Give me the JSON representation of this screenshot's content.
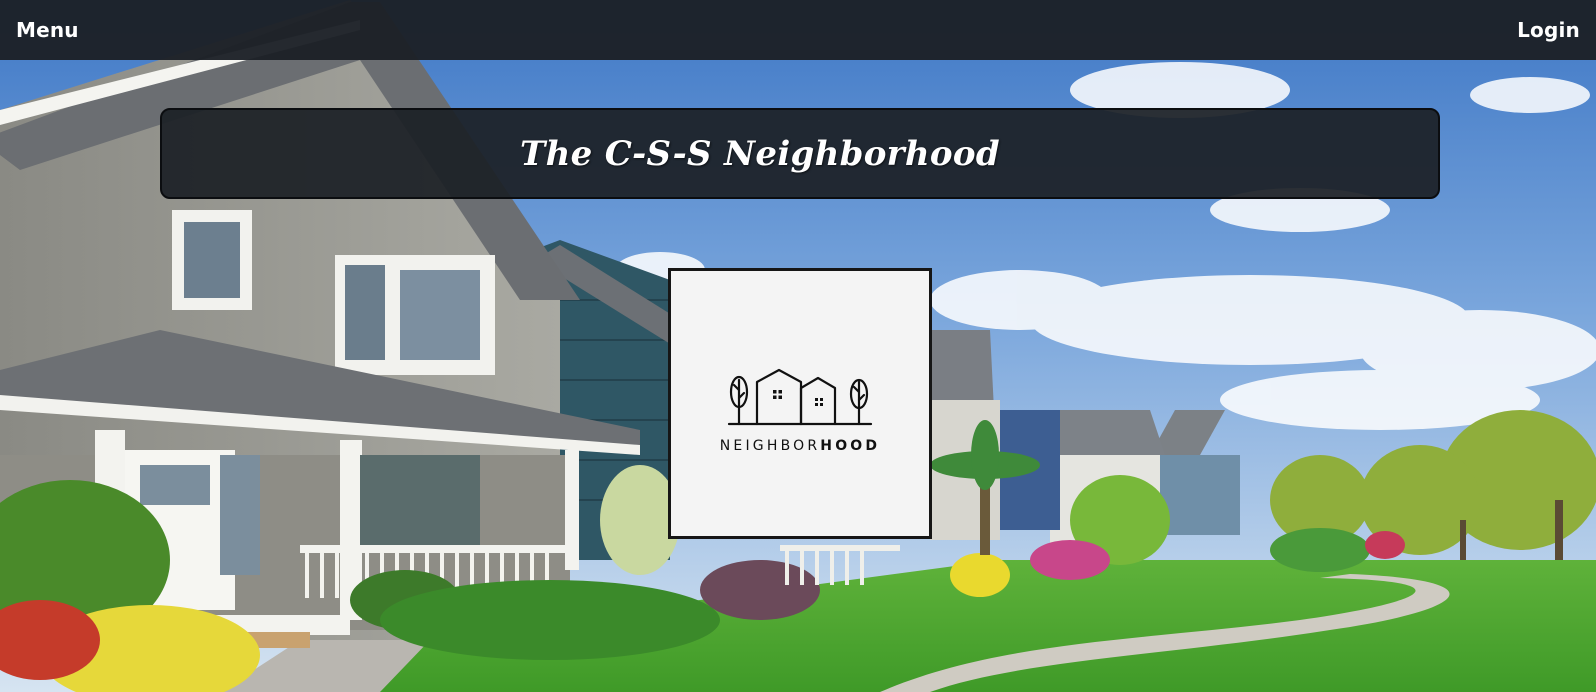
{
  "nav": {
    "menu_label": "Menu",
    "login_label": "Login"
  },
  "banner": {
    "title": "The C-S-S Neighborhood"
  },
  "logo": {
    "text_light": "NEIGHBOR",
    "text_bold": "HOOD",
    "icon": "neighborhood-houses-icon"
  },
  "colors": {
    "nav_background": "#1c2026",
    "banner_background": "#1c2026",
    "text": "#ffffff",
    "logo_card_background": "#f4f4f4"
  }
}
